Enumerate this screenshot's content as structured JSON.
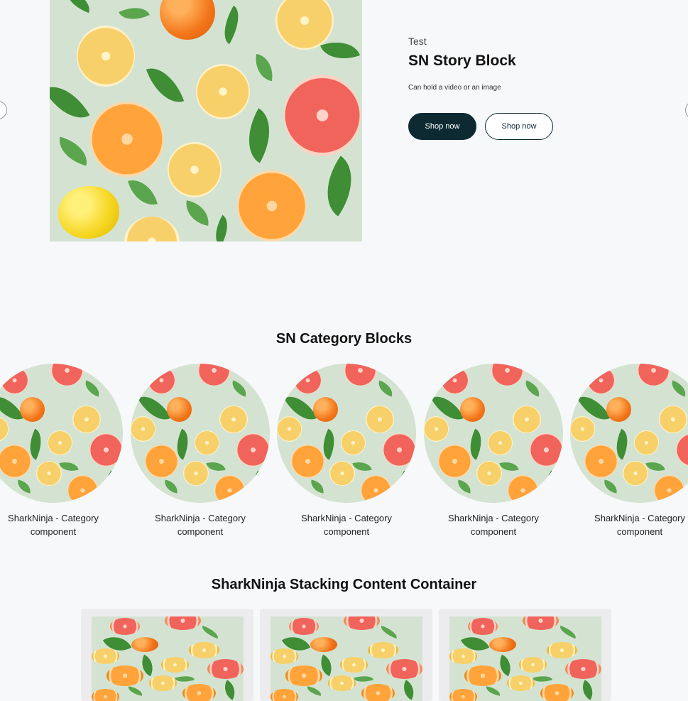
{
  "story": {
    "eyebrow": "Test",
    "title": "SN Story Block",
    "description": "Can hold a video or an image",
    "buttons": {
      "primary": "Shop now",
      "secondary": "Shop now"
    }
  },
  "category": {
    "heading": "SN Category Blocks",
    "items": [
      {
        "label": "SharkNinja - Category component"
      },
      {
        "label": "SharkNinja - Category component"
      },
      {
        "label": "SharkNinja - Category component"
      },
      {
        "label": "SharkNinja - Category component"
      },
      {
        "label": "SharkNinja - Category component"
      }
    ]
  },
  "stacking": {
    "heading": "SharkNinja Stacking Content Container"
  },
  "colors": {
    "primary_button": "#0d2a33",
    "page_bg": "#f7f8fa",
    "image_bg": "#d4e3d1"
  },
  "icons": [
    "carousel-prev-icon",
    "carousel-next-icon"
  ]
}
